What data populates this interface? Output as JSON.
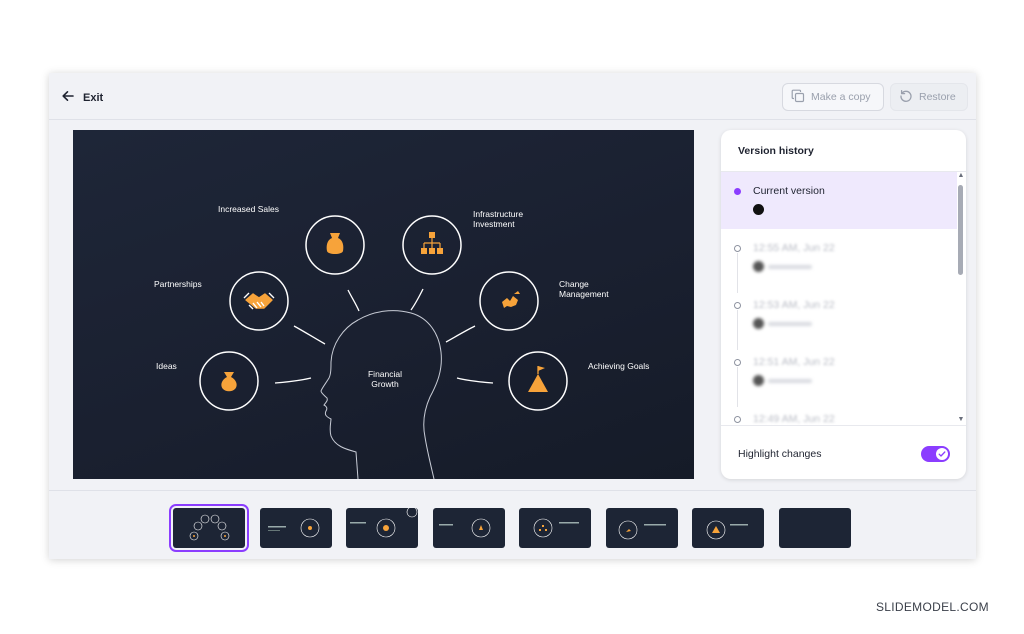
{
  "topbar": {
    "exit_label": "Exit",
    "make_copy_label": "Make a copy",
    "restore_label": "Restore",
    "icons": {
      "exit": "arrow-left-icon",
      "copy": "copy-icon",
      "restore": "restore-icon"
    }
  },
  "slide": {
    "center_label_1": "Financial",
    "center_label_2": "Growth",
    "labels": {
      "ideas": "Ideas",
      "partnerships": "Partnerships",
      "increased_sales": "Increased Sales",
      "infrastructure_1": "Infrastructure",
      "infrastructure_2": "Investment",
      "change_1": "Change",
      "change_2": "Management",
      "achieving_goals": "Achieving Goals"
    },
    "icons": [
      "money-bag-icon",
      "handshake-icon",
      "sales-bag-icon",
      "org-chart-icon",
      "puzzle-icon",
      "summit-flag-icon"
    ],
    "colors": {
      "background": "#1d2535",
      "accent": "#f7a33a",
      "outline": "#ffffff"
    }
  },
  "version_history": {
    "title": "Version history",
    "items": [
      {
        "label": "Current version",
        "current": true
      },
      {
        "label": "12:55 AM, Jun 22",
        "current": false
      },
      {
        "label": "12:53 AM, Jun 22",
        "current": false
      },
      {
        "label": "12:51 AM, Jun 22",
        "current": false
      },
      {
        "label": "12:49 AM, Jun 22",
        "current": false
      }
    ],
    "highlight_changes_label": "Highlight changes",
    "highlight_changes_on": true,
    "accent": "#8b3dff"
  },
  "filmstrip": {
    "count": 8,
    "selected_index": 0
  },
  "watermark": "SLIDEMODEL.COM"
}
